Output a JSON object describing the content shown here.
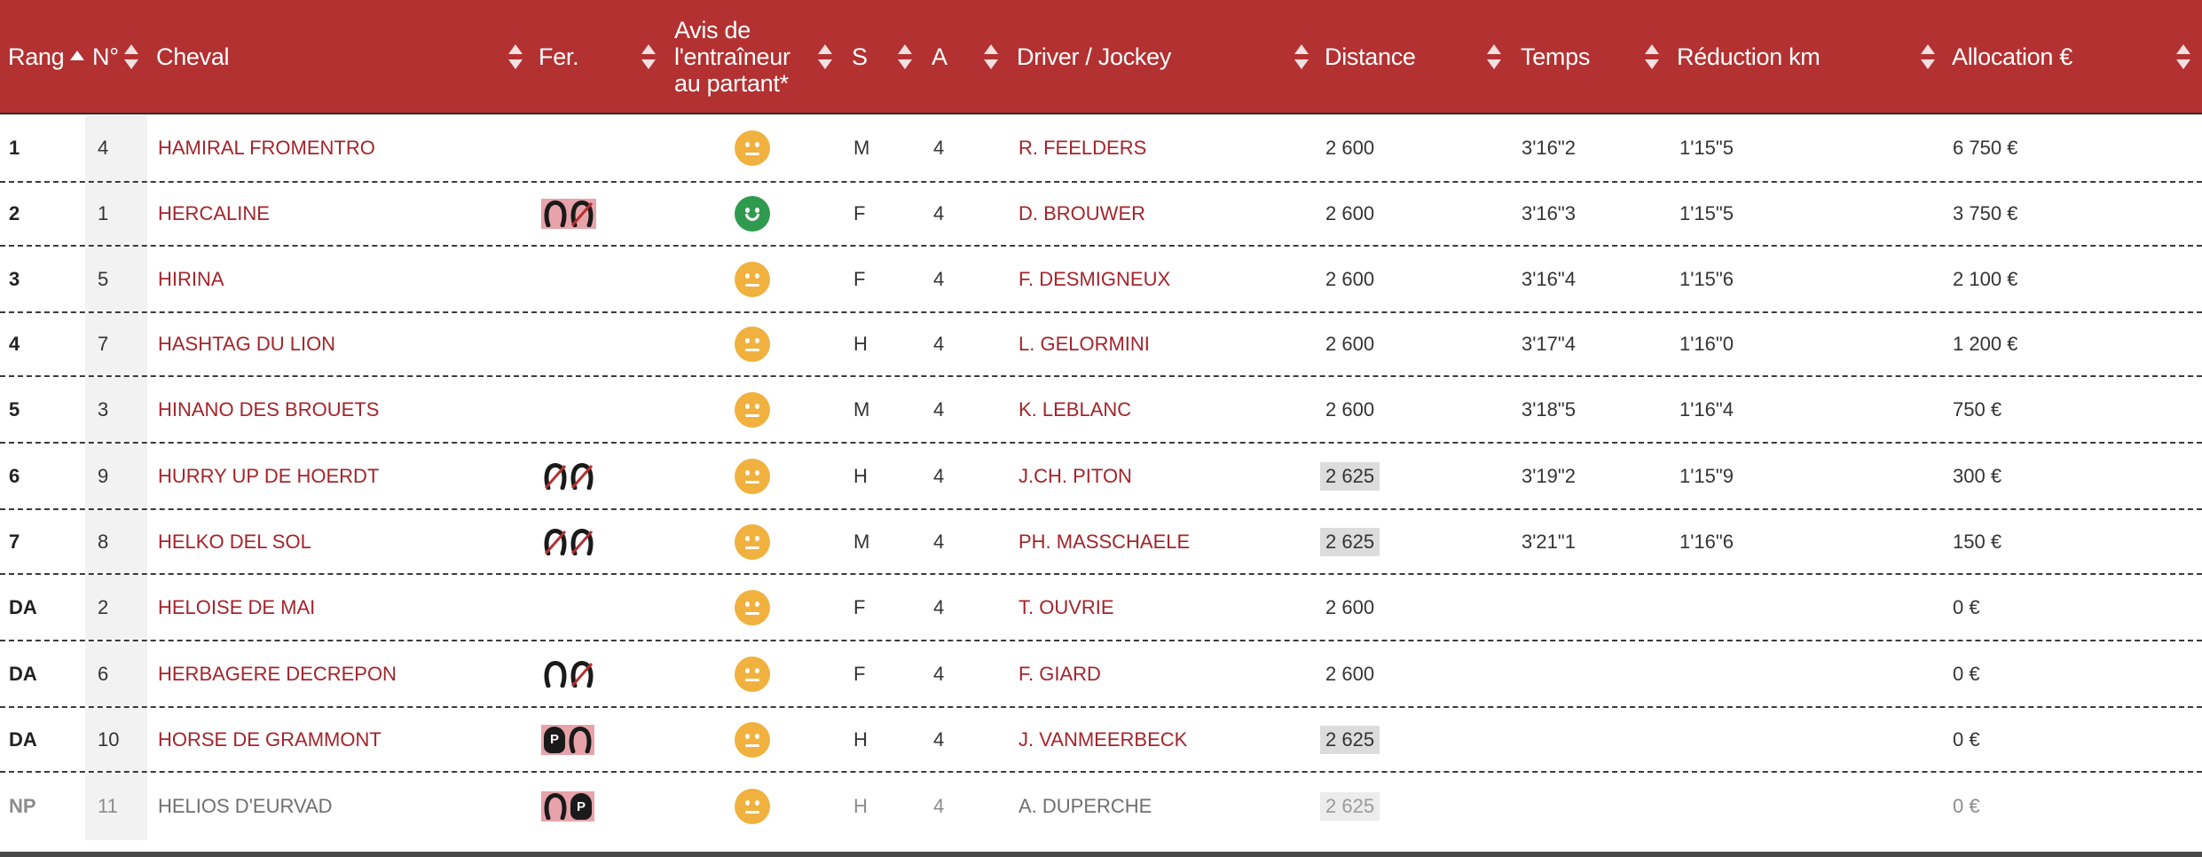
{
  "headers": {
    "rang": "Rang",
    "num": "N°",
    "cheval": "Cheval",
    "fer": "Fer.",
    "avis": "Avis de l'entraîneur au partant*",
    "s": "S",
    "a": "A",
    "driver": "Driver / Jockey",
    "distance": "Distance",
    "temps": "Temps",
    "reduction": "Réduction km",
    "allocation": "Allocation €"
  },
  "sort": {
    "column": "rang",
    "direction": "asc"
  },
  "colors": {
    "header_bg": "#b33131",
    "link": "#a3242a",
    "avis_neutral": "#f0b13f",
    "avis_positive": "#2f9a4e",
    "shoe_highlight": "#e8a3aa"
  },
  "rows": [
    {
      "rang": "1",
      "num": "4",
      "cheval": "HAMIRAL FROMENTRO",
      "fer": [],
      "fer_highlight": false,
      "avis": "neutral",
      "s": "M",
      "a": "4",
      "driver": "R. FEELDERS",
      "distance": "2 600",
      "distance_highlight": false,
      "temps": "3'16\"2",
      "reduction": "1'15\"5",
      "allocation": "6 750 €",
      "status": "arrived"
    },
    {
      "rang": "2",
      "num": "1",
      "cheval": "HERCALINE",
      "fer": [
        "shod-icon",
        "unshod-icon"
      ],
      "fer_highlight": true,
      "avis": "positive",
      "s": "F",
      "a": "4",
      "driver": "D. BROUWER",
      "distance": "2 600",
      "distance_highlight": false,
      "temps": "3'16\"3",
      "reduction": "1'15\"5",
      "allocation": "3 750 €",
      "status": "arrived"
    },
    {
      "rang": "3",
      "num": "5",
      "cheval": "HIRINA",
      "fer": [],
      "fer_highlight": false,
      "avis": "neutral",
      "s": "F",
      "a": "4",
      "driver": "F. DESMIGNEUX",
      "distance": "2 600",
      "distance_highlight": false,
      "temps": "3'16\"4",
      "reduction": "1'15\"6",
      "allocation": "2 100 €",
      "status": "arrived"
    },
    {
      "rang": "4",
      "num": "7",
      "cheval": "HASHTAG DU LION",
      "fer": [],
      "fer_highlight": false,
      "avis": "neutral",
      "s": "H",
      "a": "4",
      "driver": "L. GELORMINI",
      "distance": "2 600",
      "distance_highlight": false,
      "temps": "3'17\"4",
      "reduction": "1'16\"0",
      "allocation": "1 200 €",
      "status": "arrived"
    },
    {
      "rang": "5",
      "num": "3",
      "cheval": "HINANO DES BROUETS",
      "fer": [],
      "fer_highlight": false,
      "avis": "neutral",
      "s": "M",
      "a": "4",
      "driver": "K. LEBLANC",
      "distance": "2 600",
      "distance_highlight": false,
      "temps": "3'18\"5",
      "reduction": "1'16\"4",
      "allocation": "750 €",
      "status": "arrived"
    },
    {
      "rang": "6",
      "num": "9",
      "cheval": "HURRY UP DE HOERDT",
      "fer": [
        "unshod-icon",
        "unshod-icon"
      ],
      "fer_highlight": false,
      "avis": "neutral",
      "s": "H",
      "a": "4",
      "driver": "J.CH. PITON",
      "distance": "2 625",
      "distance_highlight": true,
      "temps": "3'19\"2",
      "reduction": "1'15\"9",
      "allocation": "300 €",
      "status": "arrived"
    },
    {
      "rang": "7",
      "num": "8",
      "cheval": "HELKO DEL SOL",
      "fer": [
        "unshod-icon",
        "unshod-icon"
      ],
      "fer_highlight": false,
      "avis": "neutral",
      "s": "M",
      "a": "4",
      "driver": "PH. MASSCHAELE",
      "distance": "2 625",
      "distance_highlight": true,
      "temps": "3'21\"1",
      "reduction": "1'16\"6",
      "allocation": "150 €",
      "status": "arrived"
    },
    {
      "rang": "DA",
      "num": "2",
      "cheval": "HELOISE DE MAI",
      "fer": [],
      "fer_highlight": false,
      "avis": "neutral",
      "s": "F",
      "a": "4",
      "driver": "T. OUVRIE",
      "distance": "2 600",
      "distance_highlight": false,
      "temps": "",
      "reduction": "",
      "allocation": "0 €",
      "status": "disqualified"
    },
    {
      "rang": "DA",
      "num": "6",
      "cheval": "HERBAGERE DECREPON",
      "fer": [
        "shod-icon",
        "unshod-icon"
      ],
      "fer_highlight": false,
      "avis": "neutral",
      "s": "F",
      "a": "4",
      "driver": "F. GIARD",
      "distance": "2 600",
      "distance_highlight": false,
      "temps": "",
      "reduction": "",
      "allocation": "0 €",
      "status": "disqualified"
    },
    {
      "rang": "DA",
      "num": "10",
      "cheval": "HORSE DE GRAMMONT",
      "fer": [
        "plate-icon",
        "shod-icon"
      ],
      "fer_highlight": true,
      "avis": "neutral",
      "s": "H",
      "a": "4",
      "driver": "J. VANMEERBECK",
      "distance": "2 625",
      "distance_highlight": true,
      "temps": "",
      "reduction": "",
      "allocation": "0 €",
      "status": "disqualified"
    },
    {
      "rang": "NP",
      "num": "11",
      "cheval": "HELIOS D'EURVAD",
      "fer": [
        "shod-icon",
        "plate-icon"
      ],
      "fer_highlight": true,
      "avis": "neutral",
      "s": "H",
      "a": "4",
      "driver": "A. DUPERCHE",
      "distance": "2 625",
      "distance_highlight": true,
      "temps": "",
      "reduction": "",
      "allocation": "0 €",
      "status": "non-partant"
    }
  ]
}
